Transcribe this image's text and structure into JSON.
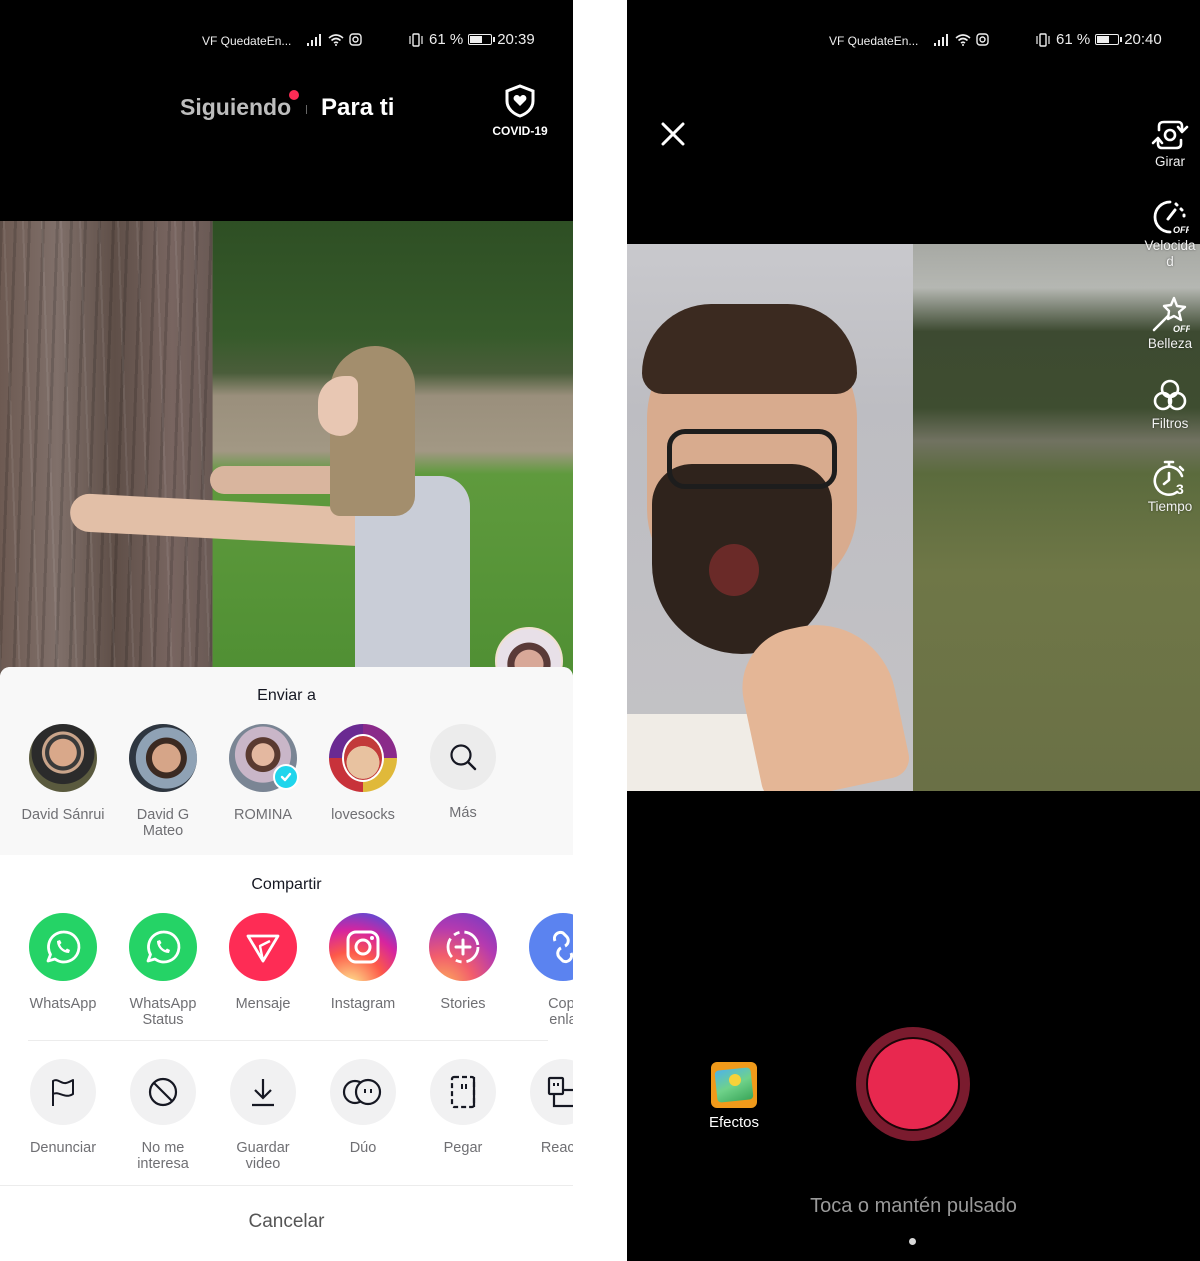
{
  "left_screen": {
    "status_bar": {
      "carrier": "VF QuedateEn...",
      "battery_percent_text": "61 %",
      "battery_level": 0.61,
      "time": "20:39"
    },
    "top_nav": {
      "tabs": [
        {
          "label": "Siguiendo",
          "active": false,
          "has_notification_dot": true
        },
        {
          "label": "Para ti",
          "active": true
        }
      ],
      "covid_button": {
        "label": "COVID-19",
        "icon": "shield-heart-icon"
      }
    },
    "share_sheet": {
      "send_to": {
        "title": "Enviar a",
        "contacts": [
          {
            "name": "David Sánrui",
            "verified": false
          },
          {
            "name": "David G Mateo",
            "name_lines": [
              "David G",
              "Mateo"
            ],
            "verified": false
          },
          {
            "name": "ROMINA",
            "verified": true
          },
          {
            "name": "lovesocks",
            "verified": false
          },
          {
            "name": "Más",
            "icon": "search-icon"
          }
        ]
      },
      "share": {
        "title": "Compartir",
        "apps": [
          {
            "label": "WhatsApp",
            "label_lines": [
              "WhatsApp"
            ],
            "icon": "whatsapp-icon",
            "color": "#25d366"
          },
          {
            "label": "WhatsApp Status",
            "label_lines": [
              "WhatsApp",
              "Status"
            ],
            "icon": "whatsapp-icon",
            "color": "#25d366"
          },
          {
            "label": "Mensaje",
            "label_lines": [
              "Mensaje"
            ],
            "icon": "send-message-icon",
            "color": "#fe2c55"
          },
          {
            "label": "Instagram",
            "label_lines": [
              "Instagram"
            ],
            "icon": "instagram-icon",
            "color": "#d6249f"
          },
          {
            "label": "Stories",
            "label_lines": [
              "Stories"
            ],
            "icon": "stories-add-icon",
            "color": "#9b36b7"
          },
          {
            "label": "Copiar enlace",
            "label_lines": [
              "Copi",
              "enla"
            ],
            "icon": "link-icon",
            "color": "#5b83f0"
          }
        ]
      },
      "actions": [
        {
          "label": "Denunciar",
          "label_lines": [
            "Denunciar"
          ],
          "icon": "flag-icon"
        },
        {
          "label": "No me interesa",
          "label_lines": [
            "No me",
            "interesa"
          ],
          "icon": "not-interested-icon"
        },
        {
          "label": "Guardar video",
          "label_lines": [
            "Guardar",
            "video"
          ],
          "icon": "download-icon"
        },
        {
          "label": "Dúo",
          "label_lines": [
            "Dúo"
          ],
          "icon": "duet-icon"
        },
        {
          "label": "Pegar",
          "label_lines": [
            "Pegar"
          ],
          "icon": "stitch-icon"
        },
        {
          "label": "Reaccionar",
          "label_lines": [
            "Reacci"
          ],
          "icon": "react-icon"
        }
      ],
      "cancel_label": "Cancelar"
    }
  },
  "right_screen": {
    "status_bar": {
      "carrier": "VF QuedateEn...",
      "battery_percent_text": "61 %",
      "battery_level": 0.61,
      "time": "20:40"
    },
    "tools": [
      {
        "label": "Girar",
        "label_lines": [
          "Girar"
        ],
        "icon": "flip-camera-icon"
      },
      {
        "label": "Velocidad",
        "label_lines": [
          "Velocida",
          "d"
        ],
        "icon": "speed-off-icon",
        "state": "OFF"
      },
      {
        "label": "Belleza",
        "label_lines": [
          "Belleza"
        ],
        "icon": "beauty-wand-off-icon",
        "state": "OFF"
      },
      {
        "label": "Filtros",
        "label_lines": [
          "Filtros"
        ],
        "icon": "filters-icon"
      },
      {
        "label": "Tiempo",
        "label_lines": [
          "Tiempo"
        ],
        "icon": "timer-3-icon",
        "value": "3"
      }
    ],
    "effects_label": "Efectos",
    "record_hint": "Toca o mantén pulsado",
    "colors": {
      "record": "#e8284f",
      "record_ring": "#7a1b2e"
    }
  }
}
